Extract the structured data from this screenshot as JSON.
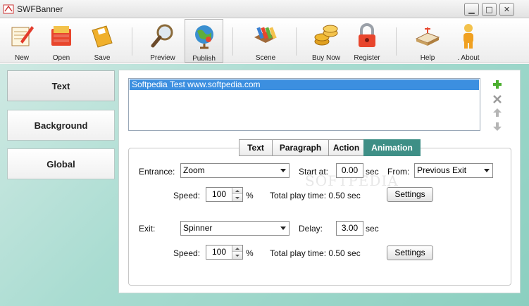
{
  "window": {
    "title": "SWFBanner"
  },
  "toolbar": {
    "new": "New",
    "open": "Open",
    "save": "Save",
    "preview": "Preview",
    "publish": "Publish",
    "scene": "Scene",
    "buy_now": "Buy Now",
    "register": "Register",
    "help": "Help",
    "about": ". About"
  },
  "sidebar": {
    "text": "Text",
    "background": "Background",
    "global": "Global"
  },
  "text_list": {
    "items": [
      "Softpedia Test www.softpedia.com"
    ]
  },
  "tabs": {
    "text": "Text",
    "paragraph": "Paragraph",
    "action": "Action",
    "animation": "Animation"
  },
  "animation": {
    "entrance_label": "Entrance:",
    "entrance_value": "Zoom",
    "start_at_label": "Start at:",
    "start_at_value": "0.00",
    "start_at_unit": "sec",
    "from_label": "From:",
    "from_value": "Previous Exit",
    "speed_label": "Speed:",
    "entrance_speed": "100",
    "percent": "%",
    "entrance_total": "Total play time: 0.50 sec",
    "settings": "Settings",
    "exit_label": "Exit:",
    "exit_value": "Spinner",
    "delay_label": "Delay:",
    "delay_value": "3.00",
    "delay_unit": "sec",
    "exit_speed": "100",
    "exit_total": "Total play time: 0.50 sec"
  },
  "watermark": "SOFTPEDIA"
}
